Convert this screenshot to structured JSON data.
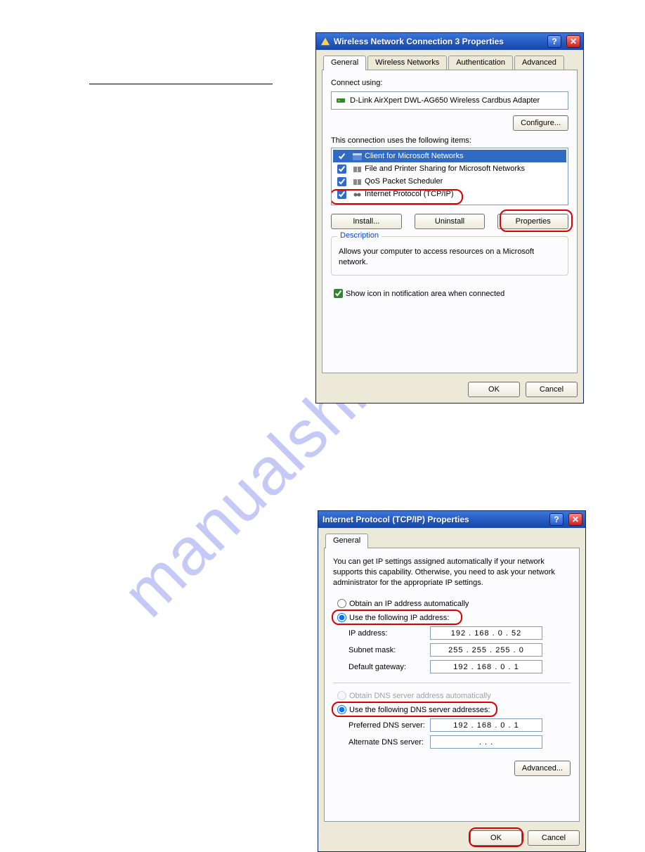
{
  "watermark": "manualshive.com",
  "dialog1": {
    "title": "Wireless Network Connection 3 Properties",
    "tabs": [
      "General",
      "Wireless Networks",
      "Authentication",
      "Advanced"
    ],
    "active_tab": 0,
    "connect_using_label": "Connect using:",
    "adapter_name": "D-Link AirXpert DWL-AG650 Wireless Cardbus Adapter",
    "configure_btn": "Configure...",
    "items_heading": "This connection uses the following items:",
    "items": [
      {
        "label": "Client for Microsoft Networks",
        "checked": true,
        "selected": true
      },
      {
        "label": "File and Printer Sharing for Microsoft Networks",
        "checked": true,
        "selected": false
      },
      {
        "label": "QoS Packet Scheduler",
        "checked": true,
        "selected": false
      },
      {
        "label": "Internet Protocol (TCP/IP)",
        "checked": true,
        "selected": false
      }
    ],
    "install_btn": "Install...",
    "uninstall_btn": "Uninstall",
    "properties_btn": "Properties",
    "description_legend": "Description",
    "description_text": "Allows your computer to access resources on a Microsoft network.",
    "show_icon_label": "Show icon in notification area when connected",
    "ok_btn": "OK",
    "cancel_btn": "Cancel"
  },
  "dialog2": {
    "title": "Internet Protocol (TCP/IP) Properties",
    "tabs": [
      "General"
    ],
    "intro_text": "You can get IP settings assigned automatically if your network supports this capability. Otherwise, you need to ask your network administrator for the appropriate IP settings.",
    "radio_auto_ip": "Obtain an IP address automatically",
    "radio_static_ip": "Use the following IP address:",
    "ip_label": "IP address:",
    "ip_value": "192 . 168 .  0  .  52",
    "mask_label": "Subnet mask:",
    "mask_value": "255 . 255 . 255 .  0",
    "gw_label": "Default gateway:",
    "gw_value": "192 . 168 .  0  .  1",
    "radio_auto_dns": "Obtain DNS server address automatically",
    "radio_static_dns": "Use the following DNS server addresses:",
    "dns1_label": "Preferred DNS server:",
    "dns1_value": "192 . 168 .  0  .  1",
    "dns2_label": "Alternate DNS server:",
    "dns2_value": " .       .       . ",
    "advanced_btn": "Advanced...",
    "ok_btn": "OK",
    "cancel_btn": "Cancel"
  }
}
